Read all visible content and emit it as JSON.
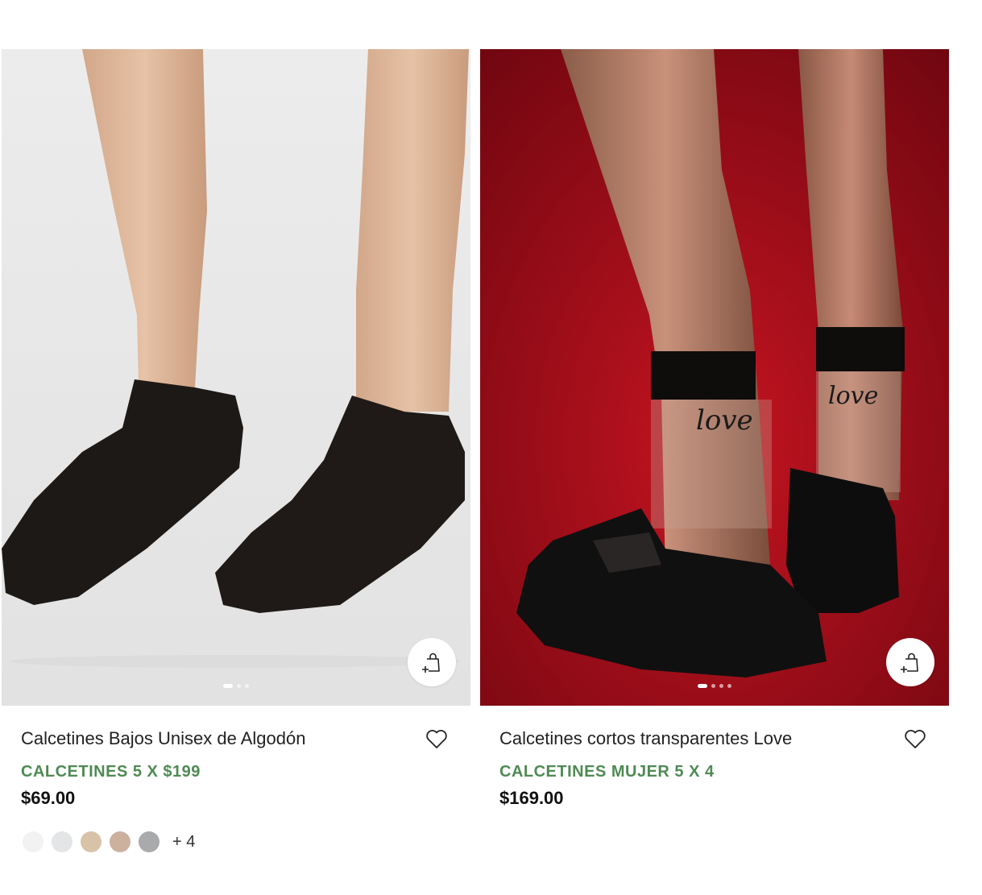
{
  "products": [
    {
      "title": "Calcetines Bajos Unisex de Algodón",
      "promo": "CALCETINES 5 X $199",
      "price": "$69.00",
      "image_desc": "black-ankle-socks-photo",
      "dots": 3,
      "swatches": [
        "#f2f2f2",
        "#e3e5e7",
        "#d8c3a8",
        "#ccb19e",
        "#a9aaac"
      ],
      "more_colors": "+ 4"
    },
    {
      "title": "Calcetines cortos transparentes Love",
      "promo": "CALCETINES MUJER 5 X 4",
      "price": "$169.00",
      "image_desc": "sheer-love-socks-photo",
      "dots": 4
    }
  ],
  "colors": {
    "promo_green": "#4f8a54",
    "price_text": "#111111"
  }
}
